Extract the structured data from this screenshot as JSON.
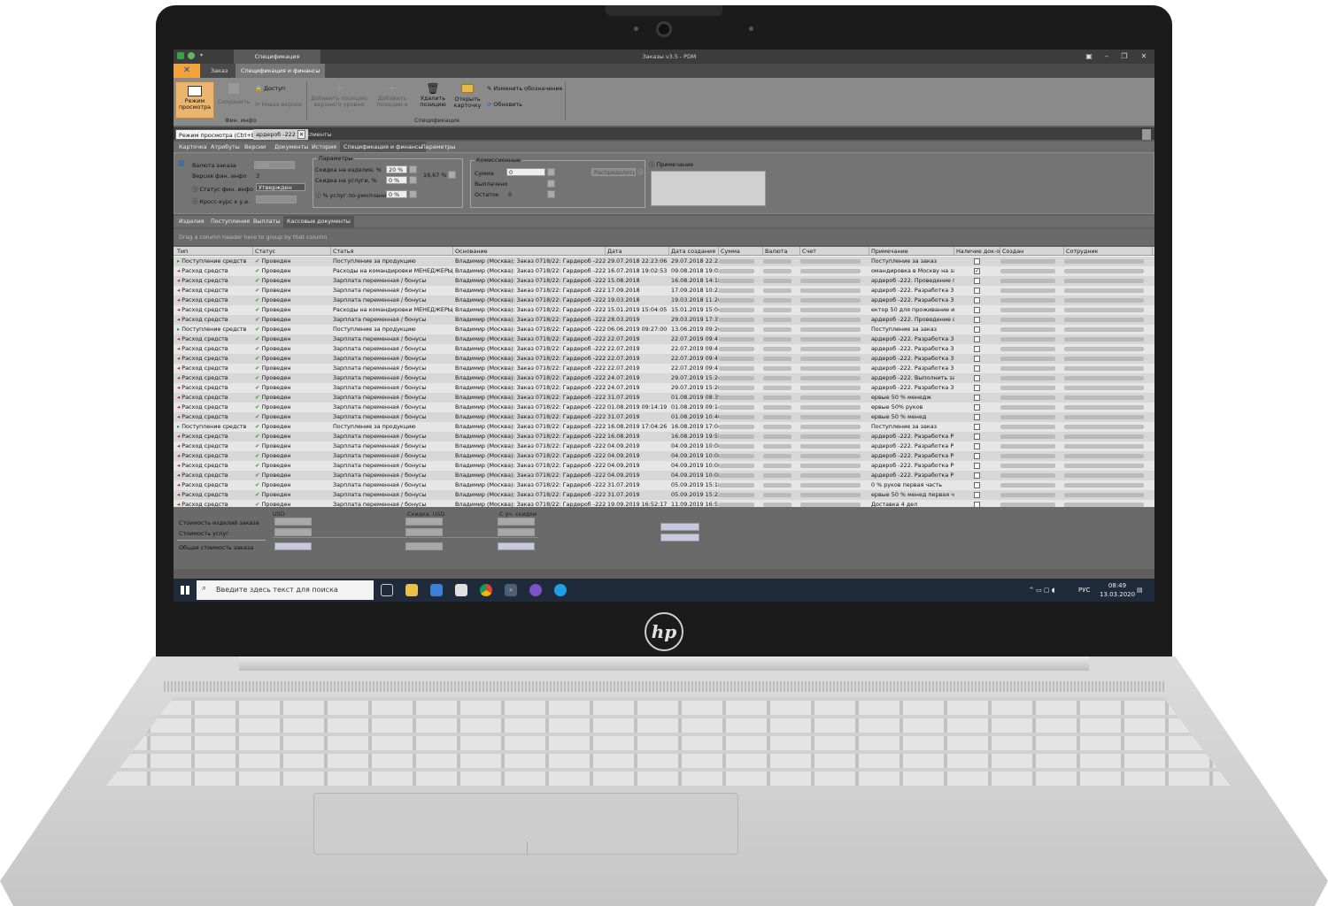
{
  "app": {
    "title": "Заказы v3.5 - PDM",
    "doc_tab_title": "Спецификация",
    "window_controls": [
      "restore-icon",
      "minimize-icon",
      "maximize-icon",
      "close-icon"
    ]
  },
  "menu": {
    "tabs": [
      "Заказ",
      "Спецификация и финансы"
    ],
    "active": "Спецификация и финансы"
  },
  "ribbon": {
    "view_mode": "Режим просмотра",
    "save": "Сохранить",
    "access": "Доступ",
    "new_version": "Новая версия",
    "group_fin": "Фин. инфо",
    "add_top": "Добавить позицию верхнего уровня",
    "add_pos": "Добавить позицию в",
    "delete_pos": "Удалить позицию",
    "open_card": "Открыть карточку",
    "rename": "Изменить обозначение",
    "refresh": "Обновить",
    "group_spec": "Спецификация"
  },
  "doc_tabs": {
    "tooltip": "Режим просмотра (Ctrl+E)",
    "order_tab": "ардероб -222",
    "clients": "Клиенты"
  },
  "nav_tabs": [
    "Карточка",
    "Атрибуты",
    "Версии",
    "Документы",
    "История",
    "Спецификация и финансы",
    "Параметры"
  ],
  "fin_panel": {
    "currency_label": "Валюта заказа",
    "currency_value": "USD",
    "version_label": "Версия фин. инфо",
    "version_value": "3",
    "status_label": "Статус фин. инфо",
    "status_value": "Утвержден",
    "rate_label": "Кросс-курс к у.е.",
    "params_title": "Параметры",
    "disc_items_label": "Скидка на изделия, %",
    "disc_items_value": "20 %",
    "disc_services_label": "Скидка на услуги, %",
    "disc_services_value": "0 %",
    "total_disc": "16,67 %",
    "services_label": "% услуг по-умолчанию",
    "services_value": "0 %",
    "commission_title": "Комиссионные",
    "sum_label": "Сумма",
    "sum_value": "0",
    "paid_label": "Выплачено",
    "rest_label": "Остаток",
    "rest_value": "0",
    "distribute": "Распределить",
    "notes_title": "Примечание"
  },
  "sub_tabs": [
    "Изделия",
    "Поступления",
    "Выплаты",
    "Кассовые документы"
  ],
  "group_hint": "Drag a column header here to group by that column",
  "grid": {
    "columns": [
      "Тип",
      "Статус",
      "Статья",
      "Основание",
      "Дата",
      "Дата создания",
      "Сумма",
      "Валюта",
      "Счет",
      "Примечание",
      "Наличие док-ов",
      "Создан",
      "Сотрудник"
    ],
    "rows": [
      {
        "type": "Поступление средств",
        "status": "Проведен",
        "article": "Поступление за продукцию",
        "basis": "Владимир (Москва): Заказ 0718/22: Гардероб -222 (про...",
        "date": "29.07.2018 22:23:06",
        "created": "29.07.2018 22:23...",
        "note": "Поступление за заказ",
        "doc": false
      },
      {
        "type": "Расход средств",
        "status": "Проведен",
        "article": "Расходы на командировки МЕНЕДЖЕРЫ/К...",
        "basis": "Владимир (Москва): Заказ 0718/22: Гардероб -222 (про...",
        "date": "16.07.2018 19:02:53",
        "created": "09.08.2018 19:02...",
        "note": "омандировка в Москву на за...",
        "doc": true
      },
      {
        "type": "Расход средств",
        "status": "Проведен",
        "article": "Зарплата переменная / бонусы",
        "basis": "Владимир (Москва): Заказ 0718/22: Гардероб -222 (про...",
        "date": "15.08.2018",
        "created": "16.08.2018 14:18...",
        "note": "ардероб -222. Проведение п...",
        "doc": false
      },
      {
        "type": "Расход средств",
        "status": "Проведен",
        "article": "Зарплата переменная / бонусы",
        "basis": "Владимир (Москва): Заказ 0718/22: Гардероб -222 (про...",
        "date": "17.09.2018",
        "created": "17.09.2018 10:22...",
        "note": "ардероб -222. Разработка З...",
        "doc": false
      },
      {
        "type": "Расход средств",
        "status": "Проведен",
        "article": "Зарплата переменная / бонусы",
        "basis": "Владимир (Москва): Заказ 0718/22: Гардероб -222 (про...",
        "date": "19.03.2018",
        "created": "19.03.2018 11:26...",
        "note": "ардероб -222. Разработка З...",
        "doc": false
      },
      {
        "type": "Расход средств",
        "status": "Проведен",
        "article": "Расходы на командировки МЕНЕДЖЕРЫ/К...",
        "basis": "Владимир (Москва): Заказ 0718/22: Гардероб -222 (про...",
        "date": "15.01.2019 15:04:05",
        "created": "15.01.2019 15:04...",
        "note": "ектор 50 для проживание и ...",
        "doc": false
      },
      {
        "type": "Расход средств",
        "status": "Проведен",
        "article": "Зарплата переменная / бонусы",
        "basis": "Владимир (Москва): Заказ 0718/22: Гардероб -222 (про...",
        "date": "28.03.2019",
        "created": "29.03.2019 17:31...",
        "note": "ардероб -222. Проведение ф...",
        "doc": false
      },
      {
        "type": "Поступление средств",
        "status": "Проведен",
        "article": "Поступление за продукцию",
        "basis": "Владимир (Москва): Заказ 0718/22: Гардероб -222 (про...",
        "date": "06.06.2019 09:27:00",
        "created": "13.06.2019 09:26...",
        "note": "Поступление за заказ",
        "doc": false
      },
      {
        "type": "Расход средств",
        "status": "Проведен",
        "article": "Зарплата переменная / бонусы",
        "basis": "Владимир (Москва): Заказ 0718/22: Гардероб -222 (про...",
        "date": "22.07.2019",
        "created": "22.07.2019 09:47...",
        "note": "ардероб -222. Разработка З...",
        "doc": false
      },
      {
        "type": "Расход средств",
        "status": "Проведен",
        "article": "Зарплата переменная / бонусы",
        "basis": "Владимир (Москва): Заказ 0718/22: Гардероб -222 (про...",
        "date": "22.07.2019",
        "created": "22.07.2019 09:47...",
        "note": "ардероб -222. Разработка З...",
        "doc": false
      },
      {
        "type": "Расход средств",
        "status": "Проведен",
        "article": "Зарплата переменная / бонусы",
        "basis": "Владимир (Москва): Заказ 0718/22: Гардероб -222 (про...",
        "date": "22.07.2019",
        "created": "22.07.2019 09:47...",
        "note": "ардероб -222. Разработка З...",
        "doc": false
      },
      {
        "type": "Расход средств",
        "status": "Проведен",
        "article": "Зарплата переменная / бонусы",
        "basis": "Владимир (Москва): Заказ 0718/22: Гардероб -222 (про...",
        "date": "22.07.2019",
        "created": "22.07.2019 09:47...",
        "note": "ардероб -222. Разработка З...",
        "doc": false
      },
      {
        "type": "Расход средств",
        "status": "Проведен",
        "article": "Зарплата переменная / бонусы",
        "basis": "Владимир (Москва): Заказ 0718/22: Гардероб -222 (про...",
        "date": "24.07.2019",
        "created": "29.07.2019 15:24...",
        "note": "ардероб -222. Выполнить за...",
        "doc": false
      },
      {
        "type": "Расход средств",
        "status": "Проведен",
        "article": "Зарплата переменная / бонусы",
        "basis": "Владимир (Москва): Заказ 0718/22: Гардероб -222 (про...",
        "date": "24.07.2019",
        "created": "29.07.2019 15:28...",
        "note": "ардероб -222. Разработка З...",
        "doc": false
      },
      {
        "type": "Расход средств",
        "status": "Проведен",
        "article": "Зарплата переменная / бонусы",
        "basis": "Владимир (Москва): Заказ 0718/22: Гардероб -222 (про...",
        "date": "31.07.2019",
        "created": "01.08.2019 08:35...",
        "note": "ервые 50 % менедж",
        "doc": false
      },
      {
        "type": "Расход средств",
        "status": "Проведен",
        "article": "Зарплата переменная / бонусы",
        "basis": "Владимир (Москва): Заказ 0718/22: Гардероб -222 (про...",
        "date": "01.08.2019 09:14:19",
        "created": "01.08.2019 09:14...",
        "note": "ервые 50% руков",
        "doc": false
      },
      {
        "type": "Расход средств",
        "status": "Проведен",
        "article": "Зарплата переменная / бонусы",
        "basis": "Владимир (Москва): Заказ 0718/22: Гардероб -222 (про...",
        "date": "31.07.2019",
        "created": "01.08.2019 10:46...",
        "note": "ервые 50 % менед",
        "doc": false
      },
      {
        "type": "Поступление средств",
        "status": "Проведен",
        "article": "Поступление за продукцию",
        "basis": "Владимир (Москва): Заказ 0718/22: Гардероб -222 (про...",
        "date": "16.08.2019 17:04:26",
        "created": "16.08.2019 17:04...",
        "note": "Поступление за заказ",
        "doc": false
      },
      {
        "type": "Расход средств",
        "status": "Проведен",
        "article": "Зарплата переменная / бонусы",
        "basis": "Владимир (Москва): Заказ 0718/22: Гардероб -222 (про...",
        "date": "16.08.2019",
        "created": "16.08.2019 19:55...",
        "note": "ардероб -222. Разработка Р...",
        "doc": false
      },
      {
        "type": "Расход средств",
        "status": "Проведен",
        "article": "Зарплата переменная / бонусы",
        "basis": "Владимир (Москва): Заказ 0718/22: Гардероб -222 (про...",
        "date": "04.09.2019",
        "created": "04.09.2019 10:08...",
        "note": "ардероб -222. Разработка Р...",
        "doc": false
      },
      {
        "type": "Расход средств",
        "status": "Проведен",
        "article": "Зарплата переменная / бонусы",
        "basis": "Владимир (Москва): Заказ 0718/22: Гардероб -222 (про...",
        "date": "04.09.2019",
        "created": "04.09.2019 10:08...",
        "note": "ардероб -222. Разработка Р...",
        "doc": false
      },
      {
        "type": "Расход средств",
        "status": "Проведен",
        "article": "Зарплата переменная / бонусы",
        "basis": "Владимир (Москва): Заказ 0718/22: Гардероб -222 (про...",
        "date": "04.09.2019",
        "created": "04.09.2019 10:08...",
        "note": "ардероб -222. Разработка Р...",
        "doc": false
      },
      {
        "type": "Расход средств",
        "status": "Проведен",
        "article": "Зарплата переменная / бонусы",
        "basis": "Владимир (Москва): Заказ 0718/22: Гардероб -222 (про...",
        "date": "04.09.2019",
        "created": "04.09.2019 10:08...",
        "note": "ардероб -222. Разработка Р...",
        "doc": false
      },
      {
        "type": "Расход средств",
        "status": "Проведен",
        "article": "Зарплата переменная / бонусы",
        "basis": "Владимир (Москва): Заказ 0718/22: Гардероб -222 (про...",
        "date": "31.07.2019",
        "created": "05.09.2019 15:18...",
        "note": "0 % руков первая часть",
        "doc": false
      },
      {
        "type": "Расход средств",
        "status": "Проведен",
        "article": "Зарплата переменная / бонусы",
        "basis": "Владимир (Москва): Заказ 0718/22: Гардероб -222 (про...",
        "date": "31.07.2019",
        "created": "05.09.2019 15:22...",
        "note": "ервые 50 % менед первая часть",
        "doc": false
      },
      {
        "type": "Расход средств",
        "status": "Проведен",
        "article": "Зарплата переменная / бонусы",
        "basis": "Владимир (Москва): Заказ 0718/22: Гардероб -222 (про...",
        "date": "19.09.2019 16:52:17",
        "created": "11.09.2019 16:52...",
        "note": "Доставка 4 дел",
        "doc": false
      }
    ]
  },
  "footer": {
    "usd": "USD",
    "with_disc": "Скидка, USD",
    "total_disc": "С уч. скидки",
    "items_cost": "Стоимость изделий заказа",
    "services_cost": "Стоимость услуг",
    "total_cost": "Общая стоимость заказа"
  },
  "taskbar": {
    "search_placeholder": "Введите здесь текст для поиска",
    "lang": "РУС",
    "time": "08:49",
    "date": "13.03.2020"
  },
  "device": {
    "brand_logo": "hp"
  },
  "colors": {
    "accent_orange": "#f2a33a",
    "status_green": "#3a9a2a",
    "taskbar": "#1f2a3a"
  }
}
